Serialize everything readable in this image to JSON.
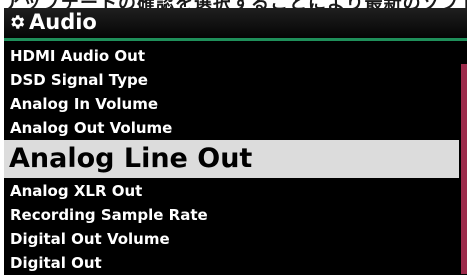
{
  "top_strip_text": "アップデートの確認を選択することにより最新のソフトウェアへの更新",
  "header": {
    "title": "Audio",
    "icon": "gear-icon"
  },
  "menu": {
    "items": [
      {
        "label": "HDMI Audio Out"
      },
      {
        "label": "DSD Signal Type"
      },
      {
        "label": "Analog In Volume"
      },
      {
        "label": "Analog Out Volume"
      },
      {
        "label": "Analog Line Out",
        "selected": true
      },
      {
        "label": "Analog XLR Out"
      },
      {
        "label": "Recording Sample Rate"
      },
      {
        "label": "Digital Out Volume"
      },
      {
        "label": "Digital Out"
      }
    ]
  },
  "colors": {
    "accent_line": "#1f8f5a",
    "selection_bg": "#dcdcdc",
    "scrollbar": "#9b2a4a"
  }
}
